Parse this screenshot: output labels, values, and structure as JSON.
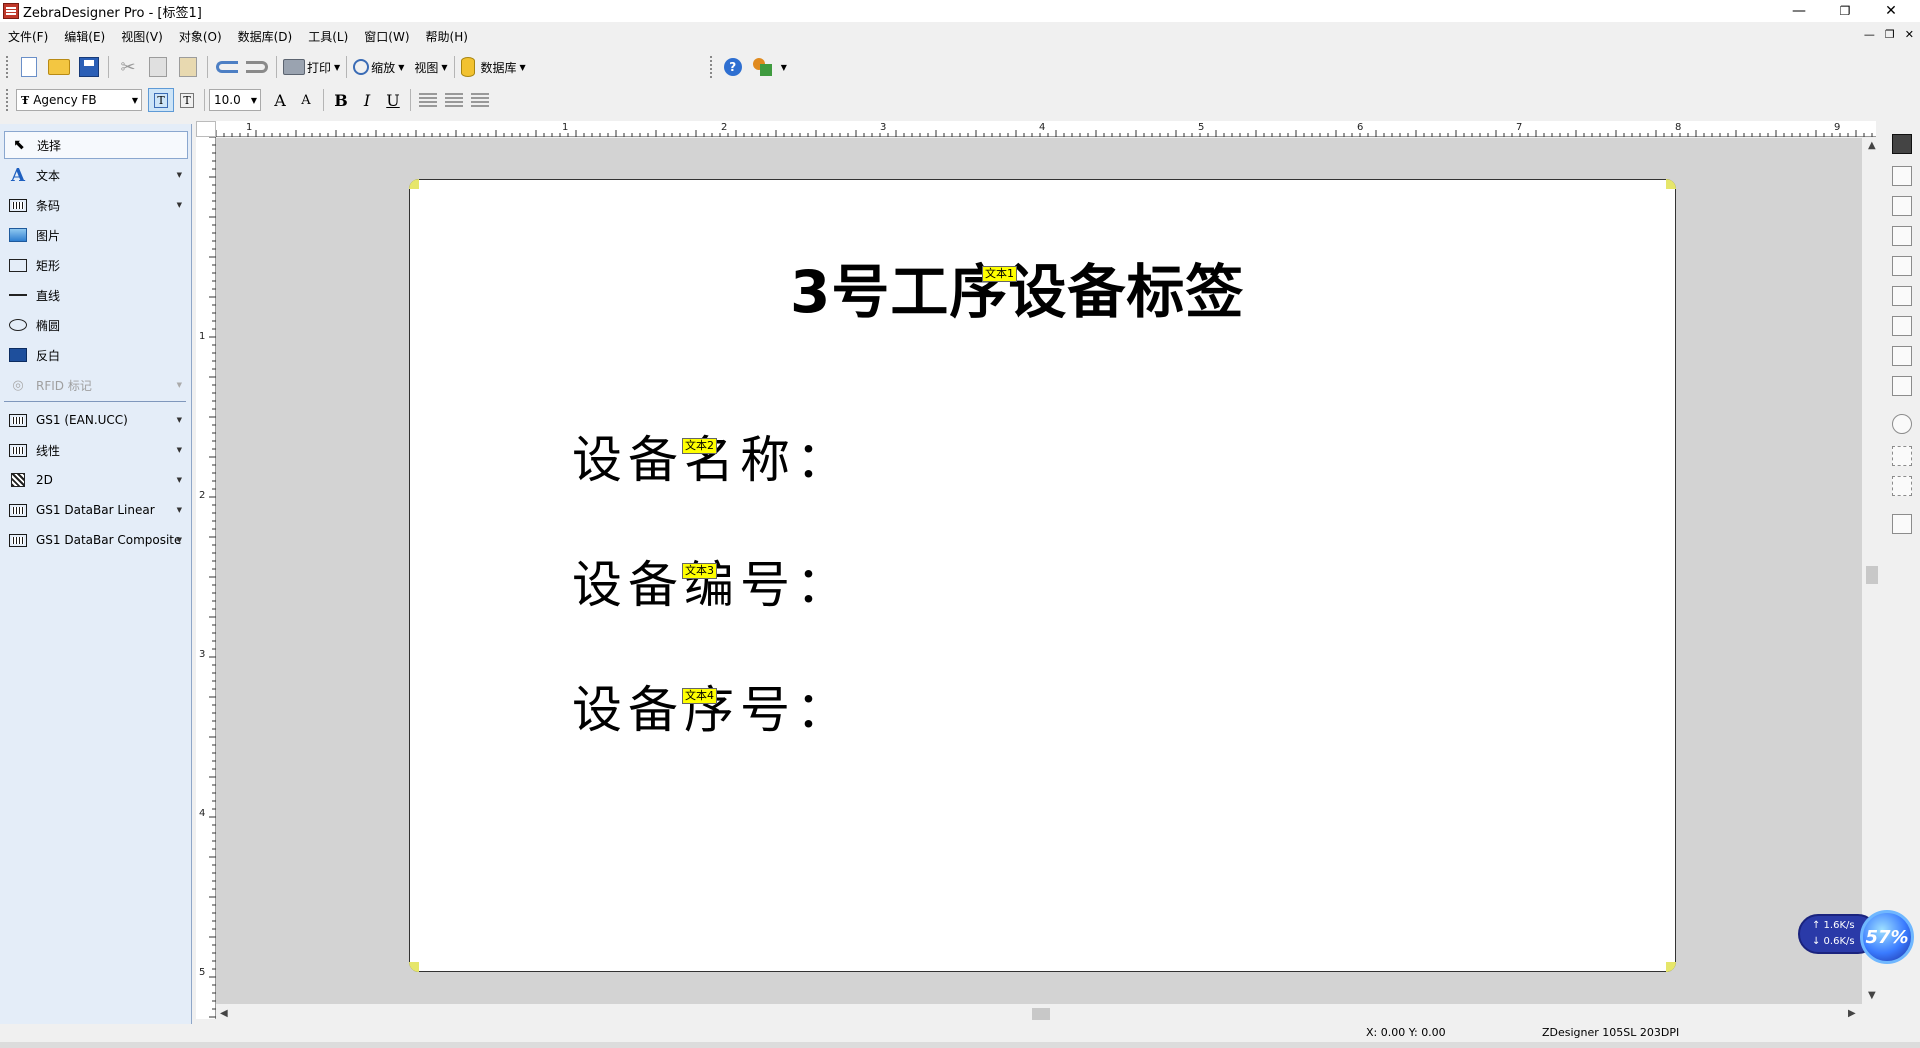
{
  "window": {
    "title": "ZebraDesigner Pro - [标签1]",
    "controls": {
      "minimize": "—",
      "restore": "❐",
      "close": "✕"
    },
    "mdi_controls": {
      "minimize": "—",
      "restore": "❐",
      "close": "✕"
    }
  },
  "menu": [
    "文件(F)",
    "编辑(E)",
    "视图(V)",
    "对象(O)",
    "数据库(D)",
    "工具(L)",
    "窗口(W)",
    "帮助(H)"
  ],
  "toolbar": {
    "print_label": "打印",
    "zoom_label": "缩放",
    "view_label": "视图",
    "database_label": "数据库",
    "help_glyph": "?"
  },
  "format_bar": {
    "font": "Agency FB",
    "font_prefix": "Ŧ",
    "size": "10.0",
    "bold": "B",
    "italic": "I",
    "underline": "U",
    "grow": "A",
    "shrink": "A"
  },
  "toolbox": {
    "items": [
      {
        "label": "选择",
        "icon": "pointer-icon"
      },
      {
        "label": "文本",
        "icon": "text-tool-icon"
      },
      {
        "label": "条码",
        "icon": "barcode-icon"
      },
      {
        "label": "图片",
        "icon": "picture-icon"
      },
      {
        "label": "矩形",
        "icon": "rectangle-icon"
      },
      {
        "label": "直线",
        "icon": "line-icon"
      },
      {
        "label": "椭圆",
        "icon": "ellipse-icon"
      },
      {
        "label": "反白",
        "icon": "inverse-icon"
      },
      {
        "label": "RFID 标记",
        "icon": "rfid-icon"
      }
    ],
    "barcode_items": [
      {
        "label": "GS1 (EAN.UCC)"
      },
      {
        "label": "线性"
      },
      {
        "label": "2D"
      },
      {
        "label": "GS1 DataBar Linear"
      },
      {
        "label": "GS1 DataBar Composite"
      }
    ]
  },
  "ruler": {
    "h_numbers": [
      "1",
      "1",
      "2",
      "3",
      "4",
      "5",
      "6",
      "7",
      "8",
      "9"
    ],
    "v_numbers": [
      "1",
      "2",
      "3",
      "4",
      "5"
    ]
  },
  "label": {
    "title": "3号工序设备标签",
    "lines": [
      "设备名称：",
      "设备编号：",
      "设备序号："
    ],
    "tags": [
      "文本1",
      "文本2",
      "文本3",
      "文本4"
    ]
  },
  "network": {
    "up": "↑ 1.6K/s",
    "down": "↓ 0.6K/s",
    "percent": "57%"
  },
  "statusbar": {
    "coords": "X: 0.00 Y: 0.00",
    "printer": "ZDesigner 105SL 203DPI"
  }
}
